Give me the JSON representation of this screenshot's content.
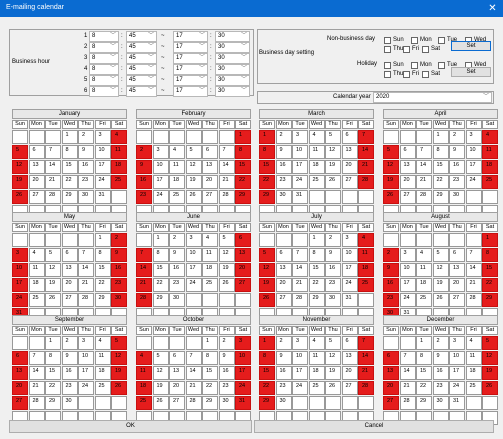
{
  "window": {
    "title": "E-mailing calendar",
    "close_glyph": "✕"
  },
  "business_hour": {
    "label": "Business hour",
    "separator": "~",
    "colon": ":",
    "rows": [
      {
        "index": "1",
        "start_h": "8",
        "start_m": "45",
        "end_h": "17",
        "end_m": "30"
      },
      {
        "index": "2",
        "start_h": "8",
        "start_m": "45",
        "end_h": "17",
        "end_m": "30"
      },
      {
        "index": "3",
        "start_h": "8",
        "start_m": "45",
        "end_h": "17",
        "end_m": "30"
      },
      {
        "index": "4",
        "start_h": "8",
        "start_m": "45",
        "end_h": "17",
        "end_m": "30"
      },
      {
        "index": "5",
        "start_h": "8",
        "start_m": "45",
        "end_h": "17",
        "end_m": "30"
      },
      {
        "index": "6",
        "start_h": "8",
        "start_m": "45",
        "end_h": "17",
        "end_m": "30"
      }
    ]
  },
  "business_day": {
    "label": "Business day setting",
    "non_business_label": "Non-business day",
    "holiday_label": "Holiday",
    "days_row1": [
      "Sun",
      "Mon",
      "Tue",
      "Wed"
    ],
    "days_row2": [
      "Thu",
      "Fri",
      "Sat"
    ],
    "set_label": "Set"
  },
  "calendar_year": {
    "label": "Calendar year",
    "value": "2020"
  },
  "weekday_headers": [
    "Sun",
    "Mon",
    "Tue",
    "Wed",
    "Thu",
    "Fri",
    "Sat"
  ],
  "months": [
    {
      "name": "January",
      "weeks": [
        [
          "",
          "",
          "",
          "1",
          "2",
          "3",
          "4"
        ],
        [
          "5",
          "6",
          "7",
          "8",
          "9",
          "10",
          "11"
        ],
        [
          "12",
          "13",
          "14",
          "15",
          "16",
          "17",
          "18"
        ],
        [
          "19",
          "20",
          "21",
          "22",
          "23",
          "24",
          "25"
        ],
        [
          "26",
          "27",
          "28",
          "29",
          "30",
          "31",
          ""
        ],
        [
          "",
          "",
          "",
          "",
          "",
          "",
          ""
        ]
      ],
      "red": [
        [
          0,
          6
        ],
        [
          1,
          0
        ],
        [
          1,
          6
        ],
        [
          2,
          0
        ],
        [
          2,
          6
        ],
        [
          3,
          0
        ],
        [
          3,
          6
        ],
        [
          4,
          0
        ]
      ]
    },
    {
      "name": "February",
      "weeks": [
        [
          "",
          "",
          "",
          "",
          "",
          "",
          "1"
        ],
        [
          "2",
          "3",
          "4",
          "5",
          "6",
          "7",
          "8"
        ],
        [
          "9",
          "10",
          "11",
          "12",
          "13",
          "14",
          "15"
        ],
        [
          "16",
          "17",
          "18",
          "19",
          "20",
          "21",
          "22"
        ],
        [
          "23",
          "24",
          "25",
          "26",
          "27",
          "28",
          "29"
        ],
        [
          "",
          "",
          "",
          "",
          "",
          "",
          ""
        ]
      ],
      "red": [
        [
          0,
          6
        ],
        [
          1,
          0
        ],
        [
          1,
          6
        ],
        [
          2,
          0
        ],
        [
          2,
          6
        ],
        [
          3,
          0
        ],
        [
          3,
          6
        ],
        [
          4,
          0
        ],
        [
          4,
          6
        ]
      ]
    },
    {
      "name": "March",
      "weeks": [
        [
          "1",
          "2",
          "3",
          "4",
          "5",
          "6",
          "7"
        ],
        [
          "8",
          "9",
          "10",
          "11",
          "12",
          "13",
          "14"
        ],
        [
          "15",
          "16",
          "17",
          "18",
          "19",
          "20",
          "21"
        ],
        [
          "22",
          "23",
          "24",
          "25",
          "26",
          "27",
          "28"
        ],
        [
          "29",
          "30",
          "31",
          "",
          "",
          "",
          ""
        ],
        [
          "",
          "",
          "",
          "",
          "",
          "",
          ""
        ]
      ],
      "red": [
        [
          0,
          0
        ],
        [
          0,
          6
        ],
        [
          1,
          0
        ],
        [
          1,
          6
        ],
        [
          2,
          0
        ],
        [
          2,
          6
        ],
        [
          3,
          0
        ],
        [
          3,
          6
        ],
        [
          4,
          0
        ]
      ]
    },
    {
      "name": "April",
      "weeks": [
        [
          "",
          "",
          "",
          "1",
          "2",
          "3",
          "4"
        ],
        [
          "5",
          "6",
          "7",
          "8",
          "9",
          "10",
          "11"
        ],
        [
          "12",
          "13",
          "14",
          "15",
          "16",
          "17",
          "18"
        ],
        [
          "19",
          "20",
          "21",
          "22",
          "23",
          "24",
          "25"
        ],
        [
          "26",
          "27",
          "28",
          "29",
          "30",
          "",
          ""
        ],
        [
          "",
          "",
          "",
          "",
          "",
          "",
          ""
        ]
      ],
      "red": [
        [
          0,
          6
        ],
        [
          1,
          0
        ],
        [
          1,
          6
        ],
        [
          2,
          0
        ],
        [
          2,
          6
        ],
        [
          3,
          0
        ],
        [
          3,
          6
        ],
        [
          4,
          0
        ]
      ]
    },
    {
      "name": "May",
      "weeks": [
        [
          "",
          "",
          "",
          "",
          "",
          "1",
          "2"
        ],
        [
          "3",
          "4",
          "5",
          "6",
          "7",
          "8",
          "9"
        ],
        [
          "10",
          "11",
          "12",
          "13",
          "14",
          "15",
          "16"
        ],
        [
          "17",
          "18",
          "19",
          "20",
          "21",
          "22",
          "23"
        ],
        [
          "24",
          "25",
          "26",
          "27",
          "28",
          "29",
          "30"
        ],
        [
          "31",
          "",
          "",
          "",
          "",
          "",
          ""
        ]
      ],
      "red": [
        [
          0,
          6
        ],
        [
          1,
          0
        ],
        [
          1,
          6
        ],
        [
          2,
          0
        ],
        [
          2,
          6
        ],
        [
          3,
          0
        ],
        [
          3,
          6
        ],
        [
          4,
          0
        ],
        [
          4,
          6
        ],
        [
          5,
          0
        ]
      ]
    },
    {
      "name": "June",
      "weeks": [
        [
          "",
          "1",
          "2",
          "3",
          "4",
          "5",
          "6"
        ],
        [
          "7",
          "8",
          "9",
          "10",
          "11",
          "12",
          "13"
        ],
        [
          "14",
          "15",
          "16",
          "17",
          "18",
          "19",
          "20"
        ],
        [
          "21",
          "22",
          "23",
          "24",
          "25",
          "26",
          "27"
        ],
        [
          "28",
          "29",
          "30",
          "",
          "",
          "",
          ""
        ],
        [
          "",
          "",
          "",
          "",
          "",
          "",
          ""
        ]
      ],
      "red": [
        [
          0,
          6
        ],
        [
          1,
          0
        ],
        [
          1,
          6
        ],
        [
          2,
          0
        ],
        [
          2,
          6
        ],
        [
          3,
          0
        ],
        [
          3,
          6
        ],
        [
          4,
          0
        ]
      ]
    },
    {
      "name": "July",
      "weeks": [
        [
          "",
          "",
          "",
          "1",
          "2",
          "3",
          "4"
        ],
        [
          "5",
          "6",
          "7",
          "8",
          "9",
          "10",
          "11"
        ],
        [
          "12",
          "13",
          "14",
          "15",
          "16",
          "17",
          "18"
        ],
        [
          "19",
          "20",
          "21",
          "22",
          "23",
          "24",
          "25"
        ],
        [
          "26",
          "27",
          "28",
          "29",
          "30",
          "31",
          ""
        ],
        [
          "",
          "",
          "",
          "",
          "",
          "",
          ""
        ]
      ],
      "red": [
        [
          0,
          6
        ],
        [
          1,
          0
        ],
        [
          1,
          6
        ],
        [
          2,
          0
        ],
        [
          2,
          6
        ],
        [
          3,
          0
        ],
        [
          3,
          6
        ],
        [
          4,
          0
        ]
      ]
    },
    {
      "name": "August",
      "weeks": [
        [
          "",
          "",
          "",
          "",
          "",
          "",
          "1"
        ],
        [
          "2",
          "3",
          "4",
          "5",
          "6",
          "7",
          "8"
        ],
        [
          "9",
          "10",
          "11",
          "12",
          "13",
          "14",
          "15"
        ],
        [
          "16",
          "17",
          "18",
          "19",
          "20",
          "21",
          "22"
        ],
        [
          "23",
          "24",
          "25",
          "26",
          "27",
          "28",
          "29"
        ],
        [
          "30",
          "31",
          "",
          "",
          "",
          "",
          ""
        ]
      ],
      "red": [
        [
          0,
          6
        ],
        [
          1,
          0
        ],
        [
          1,
          6
        ],
        [
          2,
          0
        ],
        [
          2,
          6
        ],
        [
          3,
          0
        ],
        [
          3,
          6
        ],
        [
          4,
          0
        ],
        [
          4,
          6
        ],
        [
          5,
          0
        ]
      ]
    },
    {
      "name": "September",
      "weeks": [
        [
          "",
          "",
          "1",
          "2",
          "3",
          "4",
          "5"
        ],
        [
          "6",
          "7",
          "8",
          "9",
          "10",
          "11",
          "12"
        ],
        [
          "13",
          "14",
          "15",
          "16",
          "17",
          "18",
          "19"
        ],
        [
          "20",
          "21",
          "22",
          "23",
          "24",
          "25",
          "26"
        ],
        [
          "27",
          "28",
          "29",
          "30",
          "",
          "",
          ""
        ],
        [
          "",
          "",
          "",
          "",
          "",
          "",
          ""
        ]
      ],
      "red": [
        [
          0,
          6
        ],
        [
          1,
          0
        ],
        [
          1,
          6
        ],
        [
          2,
          0
        ],
        [
          2,
          6
        ],
        [
          3,
          0
        ],
        [
          3,
          6
        ],
        [
          4,
          0
        ]
      ]
    },
    {
      "name": "October",
      "weeks": [
        [
          "",
          "",
          "",
          "",
          "1",
          "2",
          "3"
        ],
        [
          "4",
          "5",
          "6",
          "7",
          "8",
          "9",
          "10"
        ],
        [
          "11",
          "12",
          "13",
          "14",
          "15",
          "16",
          "17"
        ],
        [
          "18",
          "19",
          "20",
          "21",
          "22",
          "23",
          "24"
        ],
        [
          "25",
          "26",
          "27",
          "28",
          "29",
          "30",
          "31"
        ],
        [
          "",
          "",
          "",
          "",
          "",
          "",
          ""
        ]
      ],
      "red": [
        [
          0,
          6
        ],
        [
          1,
          0
        ],
        [
          1,
          6
        ],
        [
          2,
          0
        ],
        [
          2,
          6
        ],
        [
          3,
          0
        ],
        [
          3,
          6
        ],
        [
          4,
          0
        ],
        [
          4,
          6
        ]
      ]
    },
    {
      "name": "November",
      "weeks": [
        [
          "1",
          "2",
          "3",
          "4",
          "5",
          "6",
          "7"
        ],
        [
          "8",
          "9",
          "10",
          "11",
          "12",
          "13",
          "14"
        ],
        [
          "15",
          "16",
          "17",
          "18",
          "19",
          "20",
          "21"
        ],
        [
          "22",
          "23",
          "24",
          "25",
          "26",
          "27",
          "28"
        ],
        [
          "29",
          "30",
          "",
          "",
          "",
          "",
          ""
        ],
        [
          "",
          "",
          "",
          "",
          "",
          "",
          ""
        ]
      ],
      "red": [
        [
          0,
          0
        ],
        [
          0,
          6
        ],
        [
          1,
          0
        ],
        [
          1,
          6
        ],
        [
          2,
          0
        ],
        [
          2,
          6
        ],
        [
          3,
          0
        ],
        [
          3,
          6
        ],
        [
          4,
          0
        ]
      ]
    },
    {
      "name": "December",
      "weeks": [
        [
          "",
          "",
          "1",
          "2",
          "3",
          "4",
          "5"
        ],
        [
          "6",
          "7",
          "8",
          "9",
          "10",
          "11",
          "12"
        ],
        [
          "13",
          "14",
          "15",
          "16",
          "17",
          "18",
          "19"
        ],
        [
          "20",
          "21",
          "22",
          "23",
          "24",
          "25",
          "26"
        ],
        [
          "27",
          "28",
          "29",
          "30",
          "31",
          "",
          ""
        ],
        [
          "",
          "",
          "",
          "",
          "",
          "",
          ""
        ]
      ],
      "red": [
        [
          0,
          6
        ],
        [
          1,
          0
        ],
        [
          1,
          6
        ],
        [
          2,
          0
        ],
        [
          2,
          6
        ],
        [
          3,
          0
        ],
        [
          3,
          6
        ],
        [
          4,
          0
        ]
      ]
    }
  ],
  "footer": {
    "ok_label": "OK",
    "cancel_label": "Cancel"
  },
  "colors": {
    "titlebar": "#0a6bd1",
    "holiday": "#e51c1c",
    "chrome": "#f0f0f0"
  },
  "icons": {
    "dropdown": "chevron-down-icon",
    "close": "close-icon"
  }
}
